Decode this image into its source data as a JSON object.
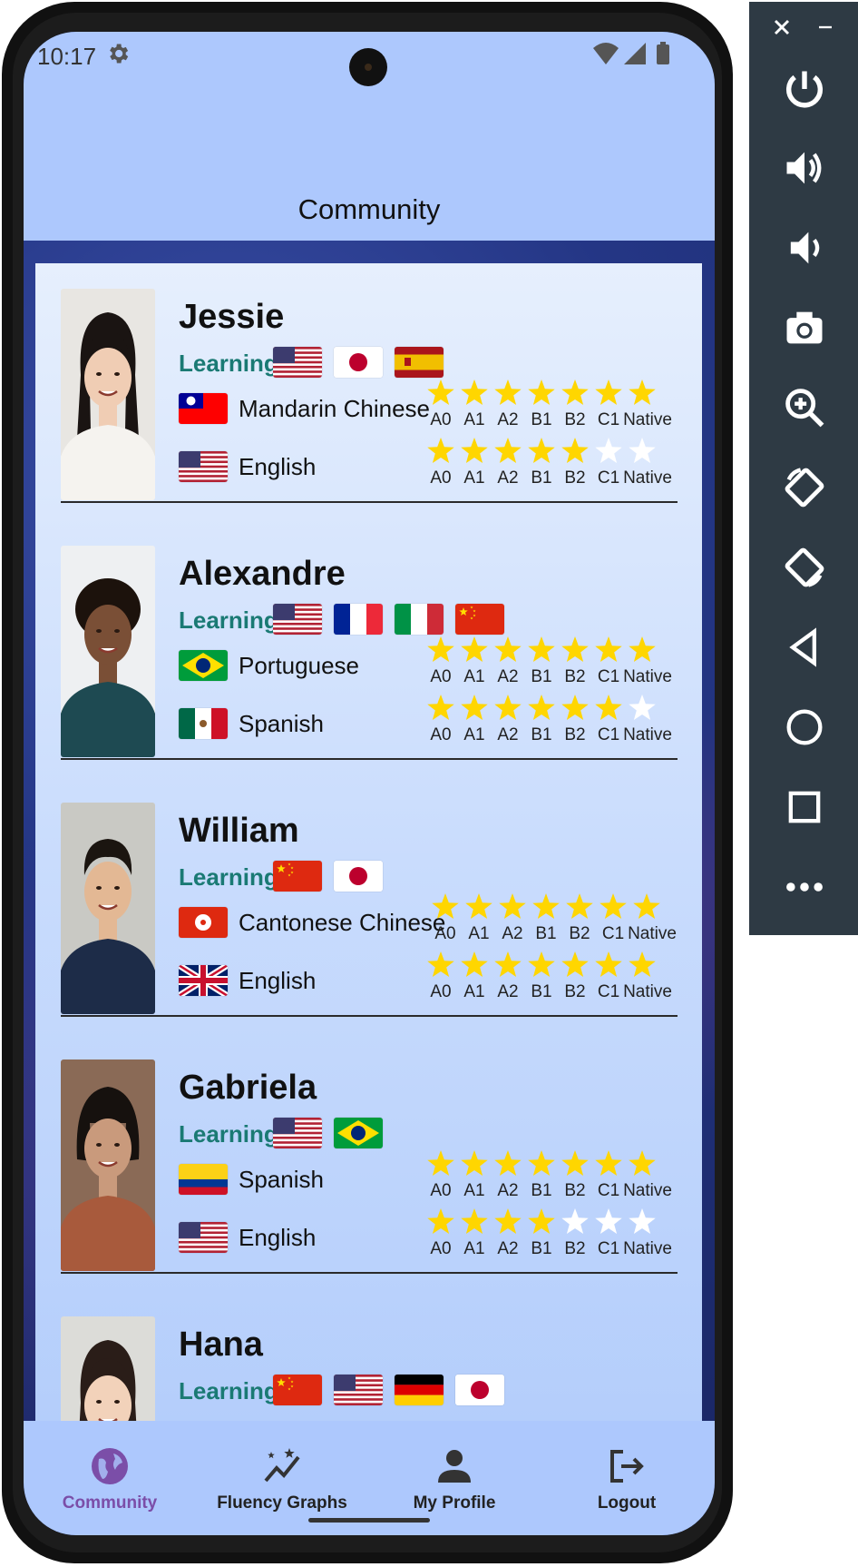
{
  "status": {
    "time": "10:17"
  },
  "app": {
    "title": "Community"
  },
  "learning_label": "Learning",
  "level_labels": [
    "A0",
    "A1",
    "A2",
    "B1",
    "B2",
    "C1",
    "Native"
  ],
  "users": [
    {
      "name": "Jessie",
      "learning_flags": [
        "us",
        "jp",
        "es"
      ],
      "languages": [
        {
          "flag": "tw",
          "label": "Mandarin Chinese",
          "stars": 7
        },
        {
          "flag": "us",
          "label": "English",
          "stars": 5
        }
      ]
    },
    {
      "name": "Alexandre",
      "learning_flags": [
        "us",
        "fr",
        "it",
        "cn"
      ],
      "languages": [
        {
          "flag": "br",
          "label": "Portuguese",
          "stars": 7
        },
        {
          "flag": "mx",
          "label": "Spanish",
          "stars": 6
        }
      ]
    },
    {
      "name": "William",
      "learning_flags": [
        "cn",
        "jp"
      ],
      "languages": [
        {
          "flag": "hk",
          "label": "Cantonese Chinese",
          "stars": 7
        },
        {
          "flag": "gb",
          "label": "English",
          "stars": 7
        }
      ]
    },
    {
      "name": "Gabriela",
      "learning_flags": [
        "us",
        "br"
      ],
      "languages": [
        {
          "flag": "co",
          "label": "Spanish",
          "stars": 7
        },
        {
          "flag": "us",
          "label": "English",
          "stars": 4
        }
      ]
    },
    {
      "name": "Hana",
      "learning_flags": [
        "cn",
        "us",
        "de",
        "jp"
      ],
      "languages": []
    }
  ],
  "nav": [
    {
      "label": "Community",
      "icon": "globe-icon",
      "active": true
    },
    {
      "label": "Fluency Graphs",
      "icon": "sparkle-chart-icon",
      "active": false
    },
    {
      "label": "My Profile",
      "icon": "person-icon",
      "active": false
    },
    {
      "label": "Logout",
      "icon": "logout-icon",
      "active": false
    }
  ],
  "emulator_panel": [
    "close-icon",
    "minimize-icon",
    "power-icon",
    "volume-up-icon",
    "volume-down-icon",
    "camera-icon",
    "zoom-icon",
    "rotate-left-icon",
    "rotate-right-icon",
    "back-icon",
    "home-icon",
    "overview-icon",
    "more-icon"
  ],
  "colors": {
    "accent": "#7b4ea8",
    "learning": "#1a7a74",
    "star_filled": "#ffd600",
    "star_empty": "#ffffff",
    "bar": "#adc8fd"
  }
}
